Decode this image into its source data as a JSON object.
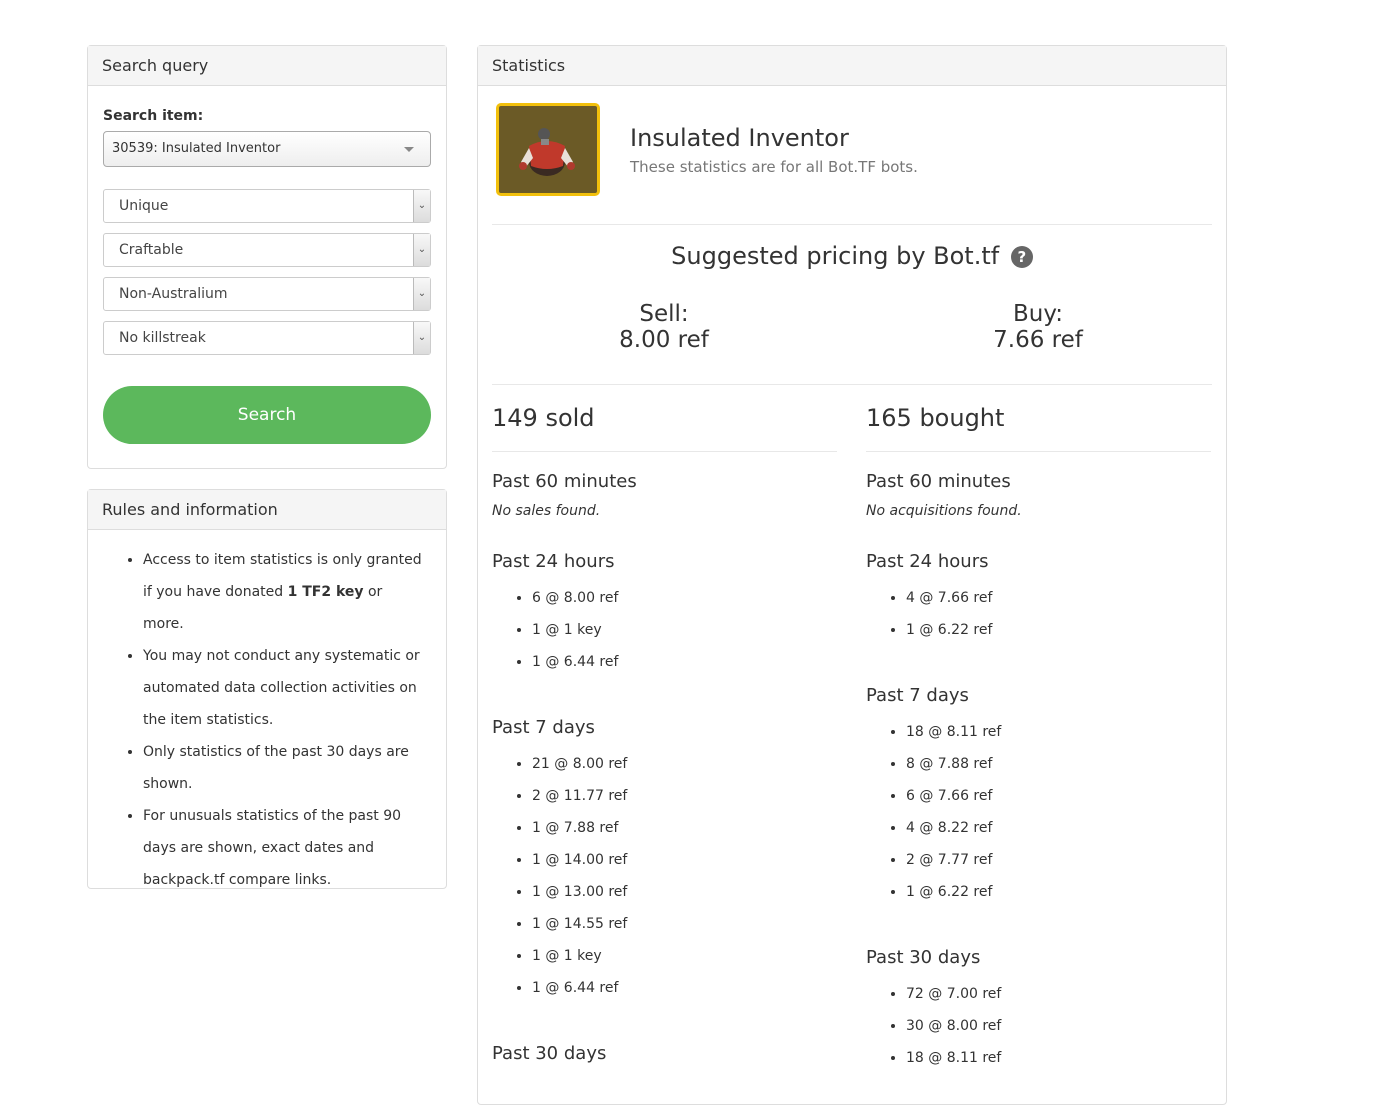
{
  "search_panel": {
    "heading": "Search query",
    "item_label": "Search item:",
    "item_value": "30539: Insulated Inventor",
    "quality": "Unique",
    "craftable": "Craftable",
    "australium": "Non-Australium",
    "killstreak": "No killstreak",
    "search_button": "Search"
  },
  "rules_panel": {
    "heading": "Rules and information",
    "rule1_pre": "Access to item statistics is only granted if you have donated ",
    "rule1_bold": "1 TF2 key",
    "rule1_post": " or more.",
    "rule2": "You may not conduct any systematic or automated data collection activities on the item statistics.",
    "rule3": "Only statistics of the past 30 days are shown.",
    "rule4": "For unusuals statistics of the past 90 days are shown, exact dates and backpack.tf compare links."
  },
  "stats": {
    "heading": "Statistics",
    "item_name": "Insulated Inventor",
    "item_sub": "These statistics are for all Bot.TF bots.",
    "suggested_title": "Suggested pricing by Bot.tf",
    "help_icon": "?",
    "sell_label": "Sell:",
    "sell_value": "8.00 ref",
    "buy_label": "Buy:",
    "buy_value": "7.66 ref",
    "sold": {
      "title": "149 sold",
      "past_60_label": "Past 60 minutes",
      "past_60_none": "No sales found.",
      "past_24_label": "Past 24 hours",
      "past_24": [
        "6 @ 8.00 ref",
        "1 @ 1 key",
        "1 @ 6.44 ref"
      ],
      "past_7_label": "Past 7 days",
      "past_7": [
        "21 @ 8.00 ref",
        "2 @ 11.77 ref",
        "1 @ 7.88 ref",
        "1 @ 14.00 ref",
        "1 @ 13.00 ref",
        "1 @ 14.55 ref",
        "1 @ 1 key",
        "1 @ 6.44 ref"
      ],
      "past_30_label": "Past 30 days"
    },
    "bought": {
      "title": "165 bought",
      "past_60_label": "Past 60 minutes",
      "past_60_none": "No acquisitions found.",
      "past_24_label": "Past 24 hours",
      "past_24": [
        "4 @ 7.66 ref",
        "1 @ 6.22 ref"
      ],
      "past_7_label": "Past 7 days",
      "past_7": [
        "18 @ 8.11 ref",
        "8 @ 7.88 ref",
        "6 @ 7.66 ref",
        "4 @ 8.22 ref",
        "2 @ 7.77 ref",
        "1 @ 6.22 ref"
      ],
      "past_30_label": "Past 30 days",
      "past_30": [
        "72 @ 7.00 ref",
        "30 @ 8.00 ref",
        "18 @ 8.11 ref"
      ]
    }
  },
  "colors": {
    "accent_green": "#5cb85c",
    "item_border": "#f2c00c",
    "item_bg": "#6b5a26"
  }
}
